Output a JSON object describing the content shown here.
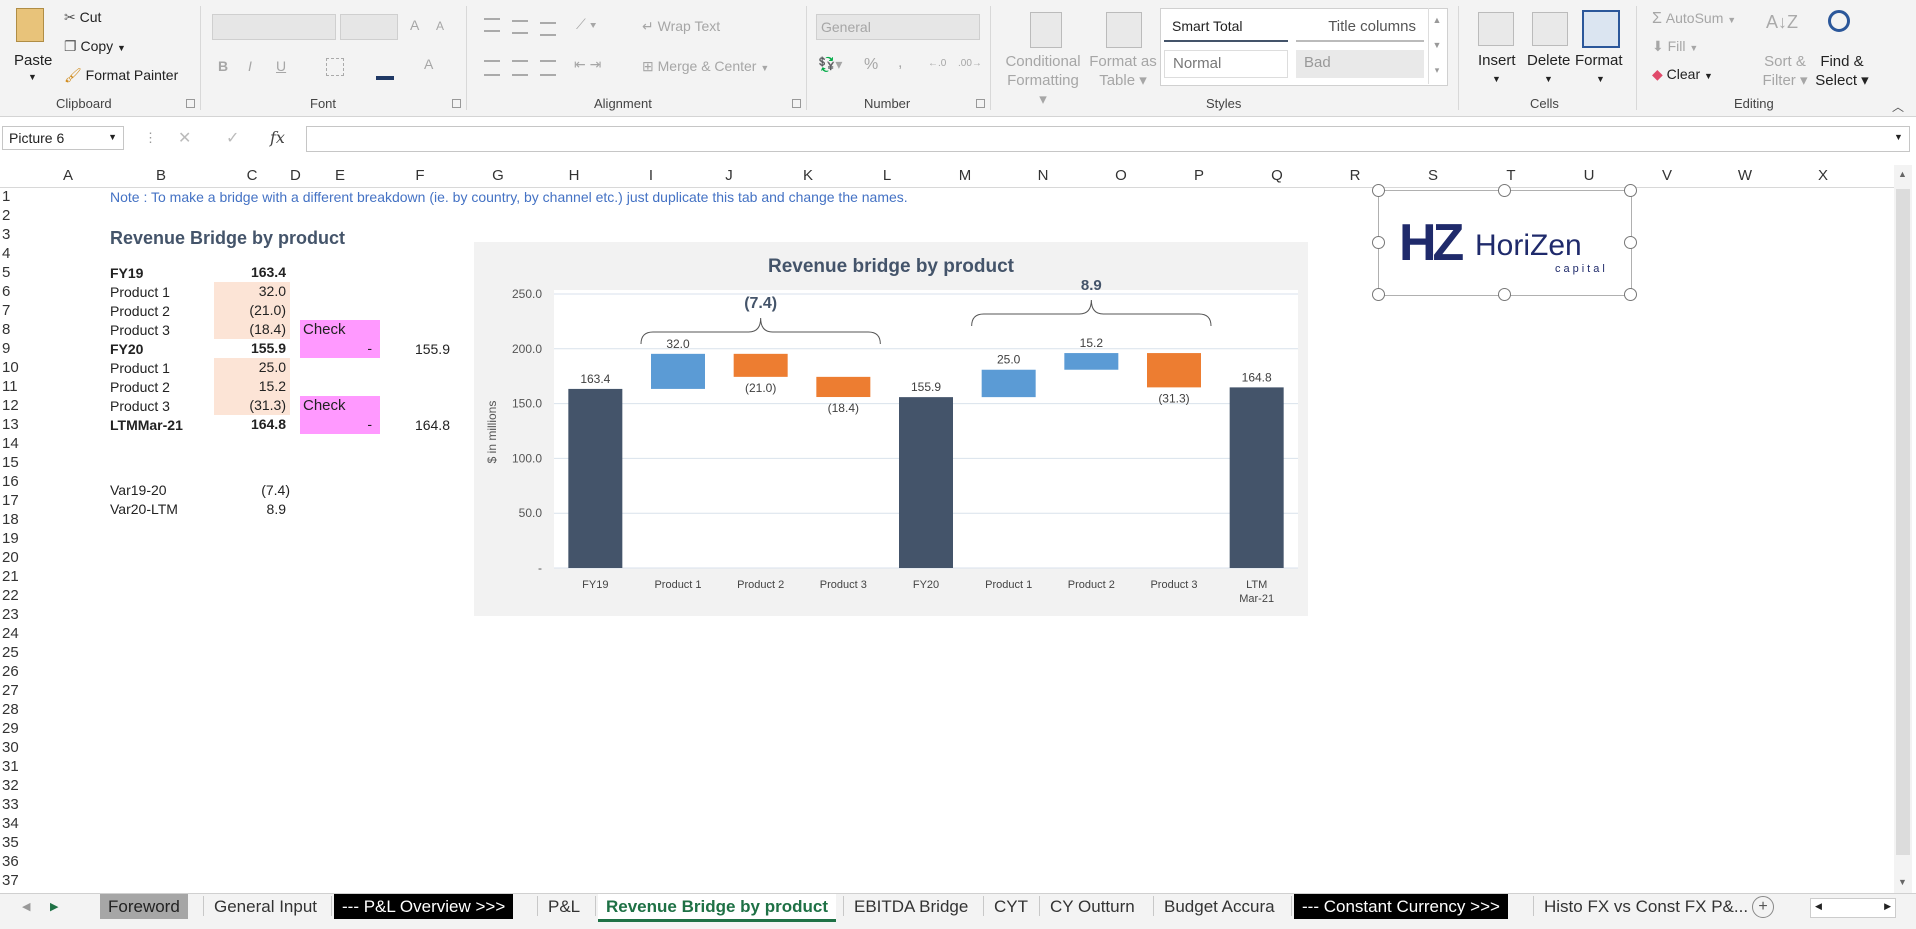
{
  "ribbon": {
    "clipboard": {
      "paste": "Paste",
      "cut": "Cut",
      "copy": "Copy",
      "format_painter": "Format Painter",
      "label": "Clipboard"
    },
    "font": {
      "label": "Font",
      "bold": "B",
      "italic": "I",
      "underline": "U",
      "grow": "A",
      "shrink": "A"
    },
    "alignment": {
      "wrap_text": "Wrap Text",
      "merge_center": "Merge & Center",
      "label": "Alignment"
    },
    "number": {
      "format": "General",
      "percent": "%",
      "comma": ",",
      "label": "Number"
    },
    "styles": {
      "conditional_formatting": "Conditional Formatting",
      "format_as_table": "Format as Table",
      "smart_total": "Smart Total",
      "title_columns": "Title columns",
      "normal": "Normal",
      "bad": "Bad",
      "label": "Styles"
    },
    "cells": {
      "insert": "Insert",
      "delete": "Delete",
      "format": "Format",
      "label": "Cells"
    },
    "editing": {
      "autosum": "AutoSum",
      "fill": "Fill",
      "clear": "Clear",
      "sort_filter": "Sort & Filter",
      "find_select": "Find & Select",
      "label": "Editing"
    }
  },
  "formula_bar": {
    "name_box": "Picture 6",
    "fx": "fx",
    "formula": ""
  },
  "columns": [
    "A",
    "B",
    "C",
    "D",
    "E",
    "F",
    "G",
    "H",
    "I",
    "J",
    "K",
    "L",
    "M",
    "N",
    "O",
    "P",
    "Q",
    "R",
    "S",
    "T",
    "U",
    "V",
    "W",
    "X"
  ],
  "rows": [
    "1",
    "2",
    "3",
    "4",
    "5",
    "6",
    "7",
    "8",
    "9",
    "10",
    "11",
    "12",
    "13",
    "14",
    "15",
    "16",
    "17",
    "18",
    "19",
    "20",
    "21",
    "22",
    "23",
    "24",
    "25",
    "26",
    "27",
    "28",
    "29",
    "30",
    "31",
    "32",
    "33",
    "34",
    "35",
    "36",
    "37"
  ],
  "sheet": {
    "note": "Note : To make a bridge with a different breakdown (ie. by country, by channel etc.) just duplicate this tab and change the names.",
    "title": "Revenue Bridge by product",
    "table": [
      {
        "label": "FY19",
        "value": "163.4",
        "bold": true
      },
      {
        "label": "Product 1",
        "value": "32.0"
      },
      {
        "label": "Product 2",
        "value": "(21.0)"
      },
      {
        "label": "Product 3",
        "value": "(18.4)",
        "check": "Check"
      },
      {
        "label": "FY20",
        "value": "155.9",
        "bold": true,
        "check_value": "-",
        "f": "155.9"
      },
      {
        "label": "Product 1",
        "value": "25.0"
      },
      {
        "label": "Product 2",
        "value": "15.2"
      },
      {
        "label": "Product 3",
        "value": "(31.3)",
        "check": "Check"
      },
      {
        "label": "LTMMar-21",
        "value": "164.8",
        "bold": true,
        "check_value": "-",
        "f": "164.8"
      }
    ],
    "var1": {
      "label": "Var19-20",
      "value": "(7.4)"
    },
    "var2": {
      "label": "Var20-LTM",
      "value": "8.9"
    }
  },
  "logo": {
    "brand": "HoriZen",
    "sub": "capital",
    "mark": "HZ"
  },
  "chart_data": {
    "type": "bar",
    "title": "Revenue bridge by product",
    "ylabel": "$ in millions",
    "ylim": [
      0,
      250
    ],
    "yticks": [
      "-",
      "50.0",
      "100.0",
      "150.0",
      "200.0",
      "250.0"
    ],
    "categories": [
      "FY19",
      "Product 1",
      "Product 2",
      "Product 3",
      "FY20",
      "Product 1",
      "Product 2",
      "Product 3",
      "LTM Mar-21"
    ],
    "bars": [
      {
        "kind": "total",
        "base": 0,
        "top": 163.4,
        "label": "163.4"
      },
      {
        "kind": "up",
        "base": 163.4,
        "top": 195.4,
        "label": "32.0"
      },
      {
        "kind": "down",
        "base": 174.4,
        "top": 195.4,
        "label": "(21.0)"
      },
      {
        "kind": "down",
        "base": 156.0,
        "top": 174.4,
        "label": "(18.4)"
      },
      {
        "kind": "total",
        "base": 0,
        "top": 155.9,
        "label": "155.9"
      },
      {
        "kind": "up",
        "base": 155.9,
        "top": 180.9,
        "label": "25.0"
      },
      {
        "kind": "up",
        "base": 180.9,
        "top": 196.1,
        "label": "15.2"
      },
      {
        "kind": "down",
        "base": 164.8,
        "top": 196.1,
        "label": "(31.3)"
      },
      {
        "kind": "total",
        "base": 0,
        "top": 164.8,
        "label": "164.8"
      }
    ],
    "brackets": [
      {
        "from": 1,
        "to": 3,
        "label": "(7.4)"
      },
      {
        "from": 5,
        "to": 7,
        "label": "8.9"
      }
    ],
    "colors": {
      "total": "#44546a",
      "up": "#5b9bd5",
      "down": "#ed7d31"
    },
    "grid": true
  },
  "tabs": [
    "Foreword",
    "General Input",
    "--- P&L Overview >>>",
    "P&L",
    "Revenue Bridge by product",
    "EBITDA Bridge",
    "CYT",
    "CY Outturn",
    "Budget Accura",
    "--- Constant Currency >>>",
    "Histo FX vs Const FX P&..."
  ]
}
